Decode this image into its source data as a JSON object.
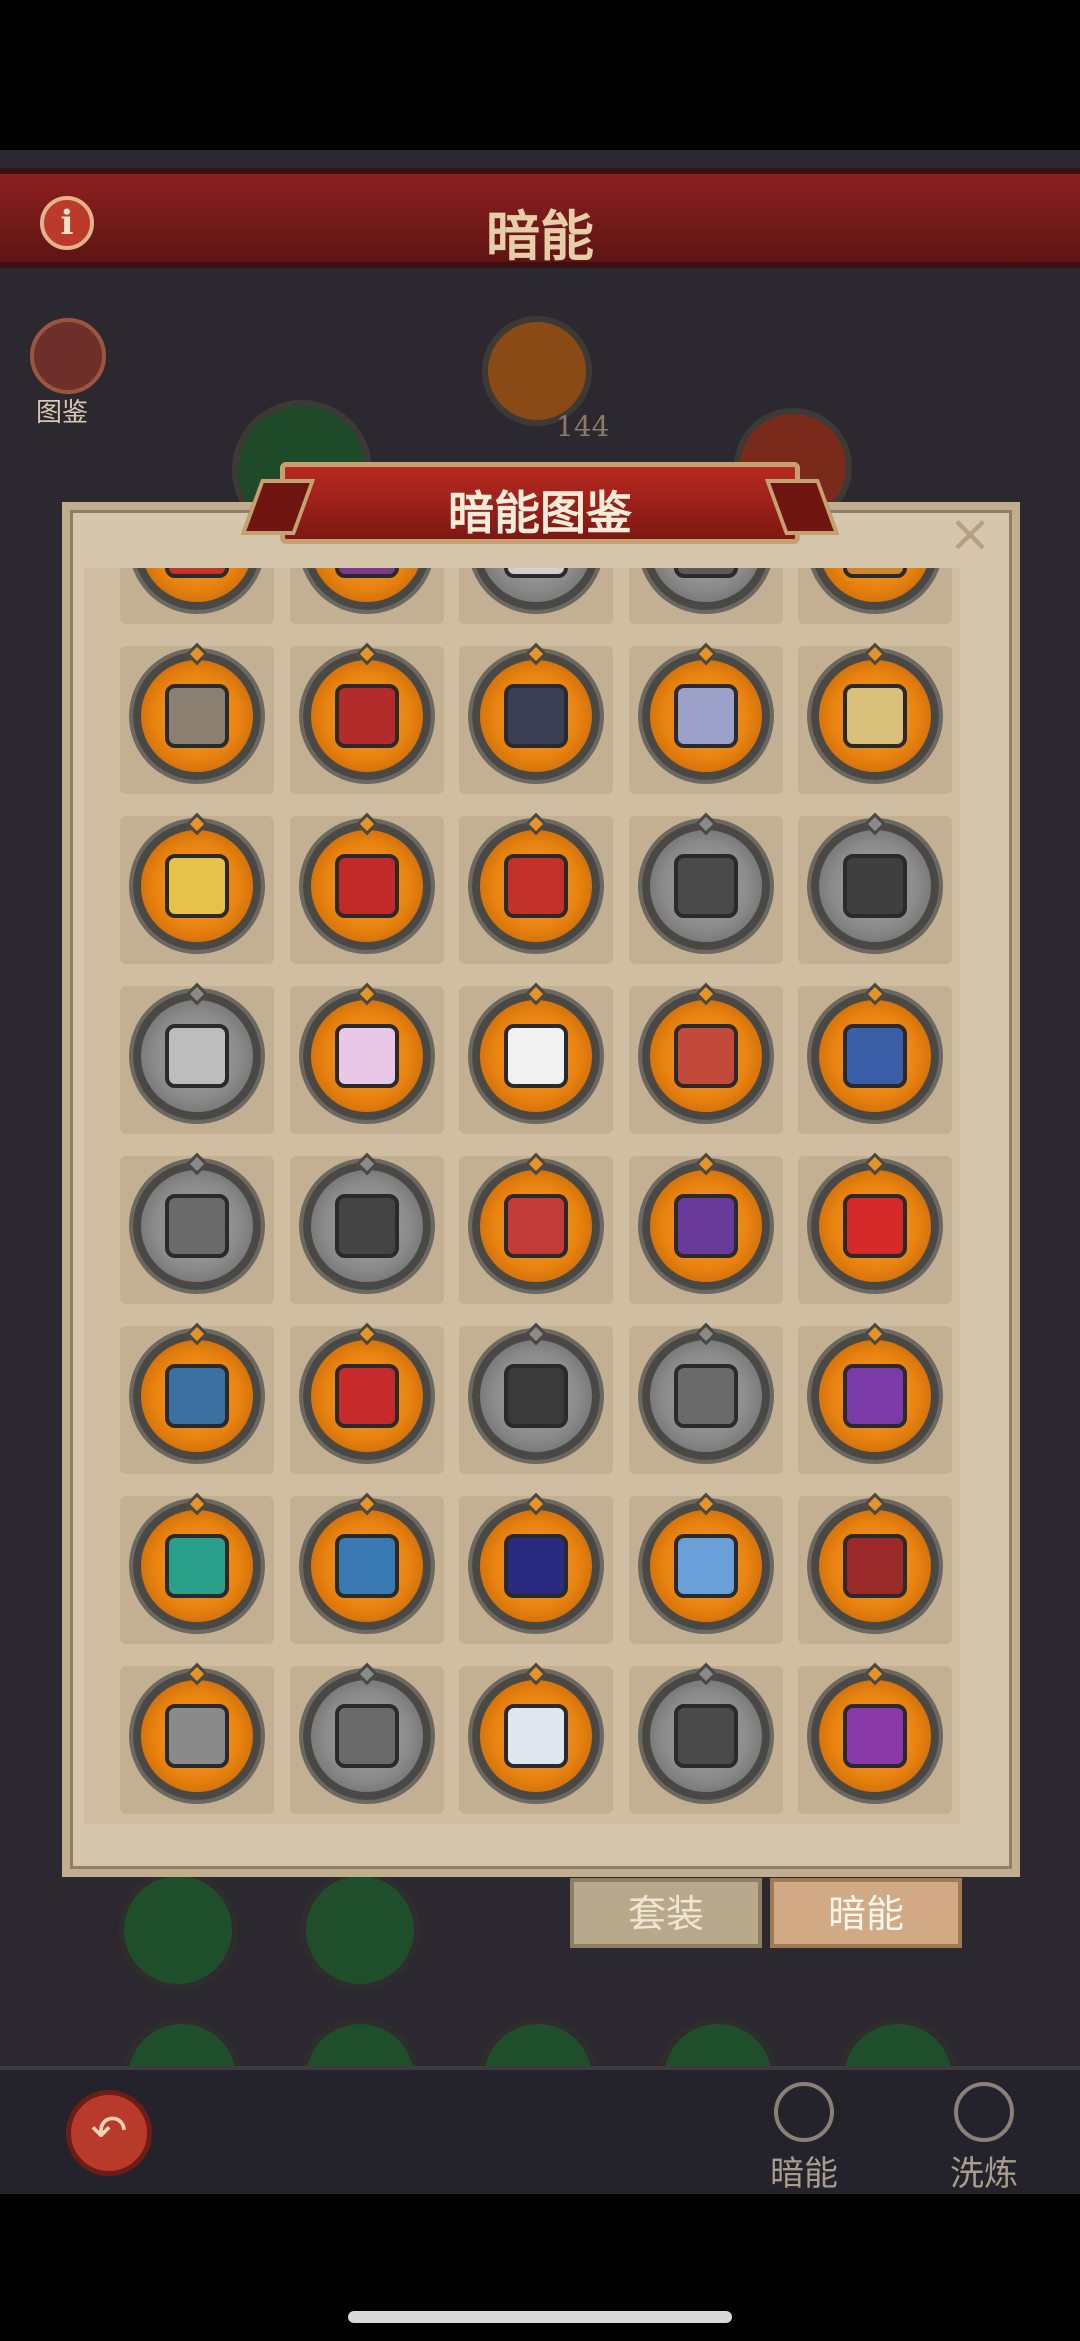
{
  "background": {
    "header_title": "暗能",
    "info_label": "i",
    "book_label": "图鉴",
    "count": "144",
    "nav": [
      {
        "label": "暗能",
        "icon": "dark-energy-icon"
      },
      {
        "label": "洗炼",
        "icon": "refine-icon"
      }
    ],
    "back_icon": "back-arrow-icon"
  },
  "modal": {
    "title": "暗能图鉴",
    "close": "×",
    "tabs": [
      {
        "label": "套装"
      },
      {
        "label": "暗能"
      }
    ],
    "grid_rows": [
      [
        "orange",
        "orange",
        "gray",
        "gray",
        "orange"
      ],
      [
        "orange",
        "orange",
        "orange",
        "orange",
        "orange"
      ],
      [
        "orange",
        "orange",
        "orange",
        "gray",
        "gray"
      ],
      [
        "gray",
        "orange",
        "orange",
        "orange",
        "orange"
      ],
      [
        "gray",
        "gray",
        "orange",
        "orange",
        "orange"
      ],
      [
        "orange",
        "orange",
        "gray",
        "gray",
        "orange"
      ],
      [
        "orange",
        "orange",
        "orange",
        "orange",
        "orange"
      ],
      [
        "orange",
        "gray",
        "orange",
        "gray",
        "orange"
      ]
    ],
    "item_names": [
      [
        "sword-icon",
        "staff-icon",
        "axe-icon",
        "blade-icon",
        "armor-icon"
      ],
      [
        "hammer-icon",
        "sword-icon",
        "helmet-icon",
        "dragon-helmet-icon",
        "golden-helmet-icon"
      ],
      [
        "golden-gauntlet-icon",
        "spiked-gauntlet-icon",
        "red-gauntlet-icon",
        "steel-gauntlet-icon",
        "iron-gauntlet-icon"
      ],
      [
        "chest-armor-icon",
        "pink-armor-icon",
        "orange-armor-icon",
        "red-armor-icon",
        "blue-armor-icon"
      ],
      [
        "gray-leggings-icon",
        "dark-leggings-icon",
        "red-boots-icon",
        "purple-boots-icon",
        "crimson-boots-icon"
      ],
      [
        "blue-hat-icon",
        "red-crown-icon",
        "dark-hat-icon",
        "gray-hood-icon",
        "purple-hat-icon"
      ],
      [
        "teal-tiara-icon",
        "blue-band-icon",
        "red-cape-icon",
        "red-amulet-icon",
        "red-necklace-icon"
      ],
      [
        "chain-icon",
        "gray-chain-icon",
        "white-emblem-icon",
        "skull-emblem-icon",
        "gold-emblem-icon"
      ]
    ],
    "item_colors": [
      [
        "#c4332a",
        "#7b3a8a",
        "#d0d0d0",
        "#5a5a5a",
        "#d0862a"
      ],
      [
        "#8a7f70",
        "#b22a2a",
        "#3a3f55",
        "#9aa0c8",
        "#d8c07a"
      ],
      [
        "#e6c24a",
        "#c22a2a",
        "#c2322a",
        "#4a4a4a",
        "#3f3f3f"
      ],
      [
        "#bdbdbd",
        "#e8c8e6",
        "#f2f2f2",
        "#c24a3a",
        "#3a5fa8"
      ],
      [
        "#6a6a6a",
        "#444444",
        "#c23a3a",
        "#6a3a9a",
        "#d42a2a"
      ],
      [
        "#3a6fa0",
        "#c72a2a",
        "#3a3a3a",
        "#6a6a6a",
        "#7a3aa8"
      ],
      [
        "#2aa08a",
        "#3a7ab2",
        "#2a2a80",
        "#6aa0d8",
        "#9a2a2a"
      ],
      [
        "#8a8a8a",
        "#6a6a6a",
        "#e0e6f0",
        "#4a4a4a",
        "#8a3aa8"
      ]
    ]
  },
  "colors": {
    "accent_orange": "#e8820f",
    "header_red": "#8e2020",
    "panel_beige": "#d6c6ab"
  }
}
